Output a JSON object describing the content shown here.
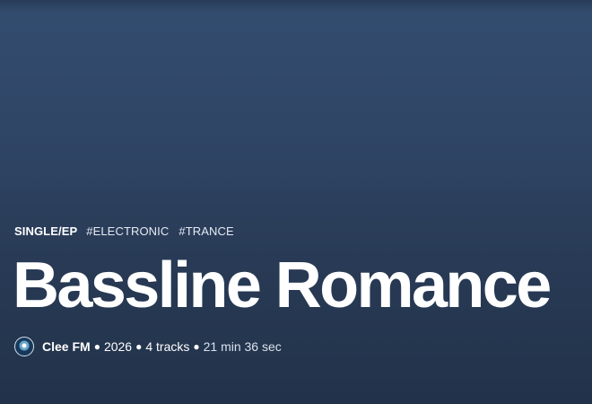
{
  "release": {
    "type_label": "SINGLE/EP",
    "tags": [
      "#ELECTRONIC",
      "#TRANCE"
    ],
    "title": "Bassline Romance",
    "artist": "Clee FM",
    "year": "2026",
    "track_count": "4 tracks",
    "duration": "21 min 36 sec",
    "separator": "●"
  },
  "icons": {
    "artist_avatar": "artist-avatar-icon"
  },
  "colors": {
    "background_top": "#334d70",
    "background_bottom": "#22324a",
    "text": "#ffffff"
  }
}
